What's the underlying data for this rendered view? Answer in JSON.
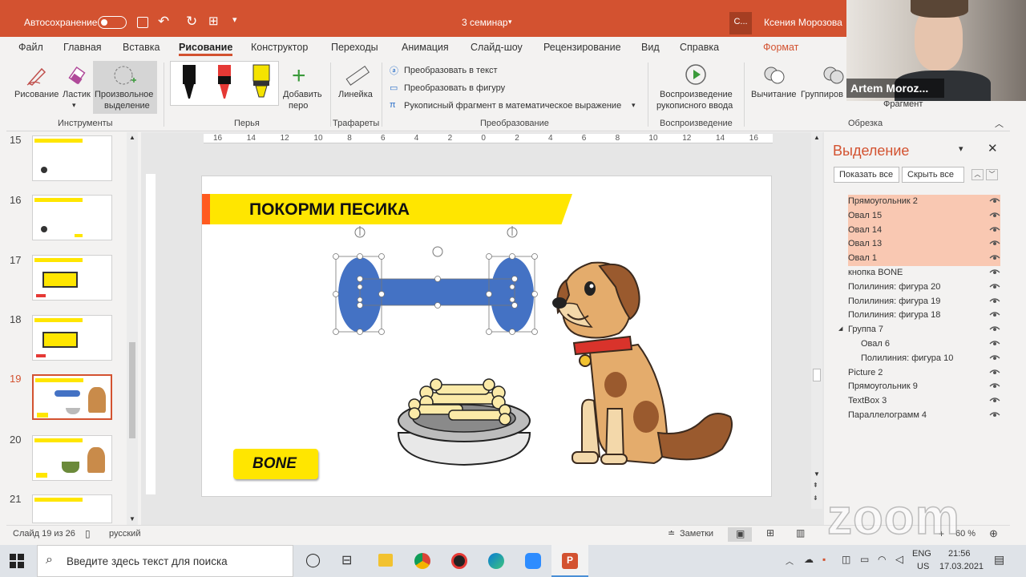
{
  "titlebar": {
    "autosave": "Автосохранение",
    "doc_title": "3 семинар",
    "user_initial": "С...",
    "user_name": "Ксения Морозова"
  },
  "tabs": [
    "Файл",
    "Главная",
    "Вставка",
    "Рисование",
    "Конструктор",
    "Переходы",
    "Анимация",
    "Слайд-шоу",
    "Рецензирование",
    "Вид",
    "Справка",
    "Формат"
  ],
  "ribbon": {
    "draw": "Рисование",
    "eraser": "Ластик",
    "lasso_1": "Произвольное",
    "lasso_2": "выделение",
    "group_tools": "Инструменты",
    "add_pen_1": "Добавить",
    "add_pen_2": "перо",
    "group_pens": "Перья",
    "ruler": "Линейка",
    "group_stencils": "Трафареты",
    "to_text": "Преобразовать в текст",
    "to_shape": "Преобразовать в фигуру",
    "to_math": "Рукописный фрагмент в математическое выражение",
    "group_convert": "Преобразование",
    "replay_1": "Воспроизведение",
    "replay_2": "рукописного ввода",
    "group_replay": "Воспроизведение",
    "subtract": "Вычитание",
    "group": "Группиров",
    "fragment": "Фрагмент",
    "group_crop": "Обрезка"
  },
  "thumbnails": [
    {
      "num": "15"
    },
    {
      "num": "16"
    },
    {
      "num": "17"
    },
    {
      "num": "18"
    },
    {
      "num": "19"
    },
    {
      "num": "20"
    },
    {
      "num": "21"
    }
  ],
  "ruler_labels": [
    "16",
    "14",
    "12",
    "10",
    "8",
    "6",
    "4",
    "2",
    "0",
    "2",
    "4",
    "6",
    "8",
    "10",
    "12",
    "14",
    "16"
  ],
  "slide": {
    "title": "ПОКОРМИ ПЕСИКА",
    "button": "BONE"
  },
  "selection_pane": {
    "title": "Выделение",
    "show_all": "Показать все",
    "hide_all": "Скрыть все",
    "items": [
      {
        "label": "Прямоугольник 2",
        "selected": true
      },
      {
        "label": "Овал 15",
        "selected": true
      },
      {
        "label": "Овал 14",
        "selected": true
      },
      {
        "label": "Овал 13",
        "selected": true
      },
      {
        "label": "Овал 1",
        "selected": true
      },
      {
        "label": "кнопка BONE",
        "selected": false
      },
      {
        "label": "Полилиния: фигура 20",
        "selected": false
      },
      {
        "label": "Полилиния: фигура 19",
        "selected": false
      },
      {
        "label": "Полилиния: фигура 18",
        "selected": false
      },
      {
        "label": "Группа 7",
        "selected": false
      },
      {
        "label": "Овал 6",
        "selected": false
      },
      {
        "label": "Полилиния: фигура 10",
        "selected": false
      },
      {
        "label": "Picture 2",
        "selected": false
      },
      {
        "label": "Прямоугольник 9",
        "selected": false
      },
      {
        "label": "TextBox 3",
        "selected": false
      },
      {
        "label": "Параллелограмм 4",
        "selected": false
      }
    ]
  },
  "status": {
    "slide": "Слайд 19 из 26",
    "lang": "русский",
    "notes": "Заметки",
    "zoom": "60 %"
  },
  "taskbar": {
    "search": "Введите здесь текст для поиска",
    "kbd_1": "ENG",
    "kbd_2": "US",
    "time": "21:56",
    "date": "17.03.2021"
  },
  "webcam": {
    "name": "Artem Moroz...",
    "zoom_logo": "zoom"
  },
  "colors": {
    "accent": "#d35230",
    "bone": "#4472c4",
    "title_bar": "#ffe600",
    "selected_row": "#f9c8b2"
  }
}
